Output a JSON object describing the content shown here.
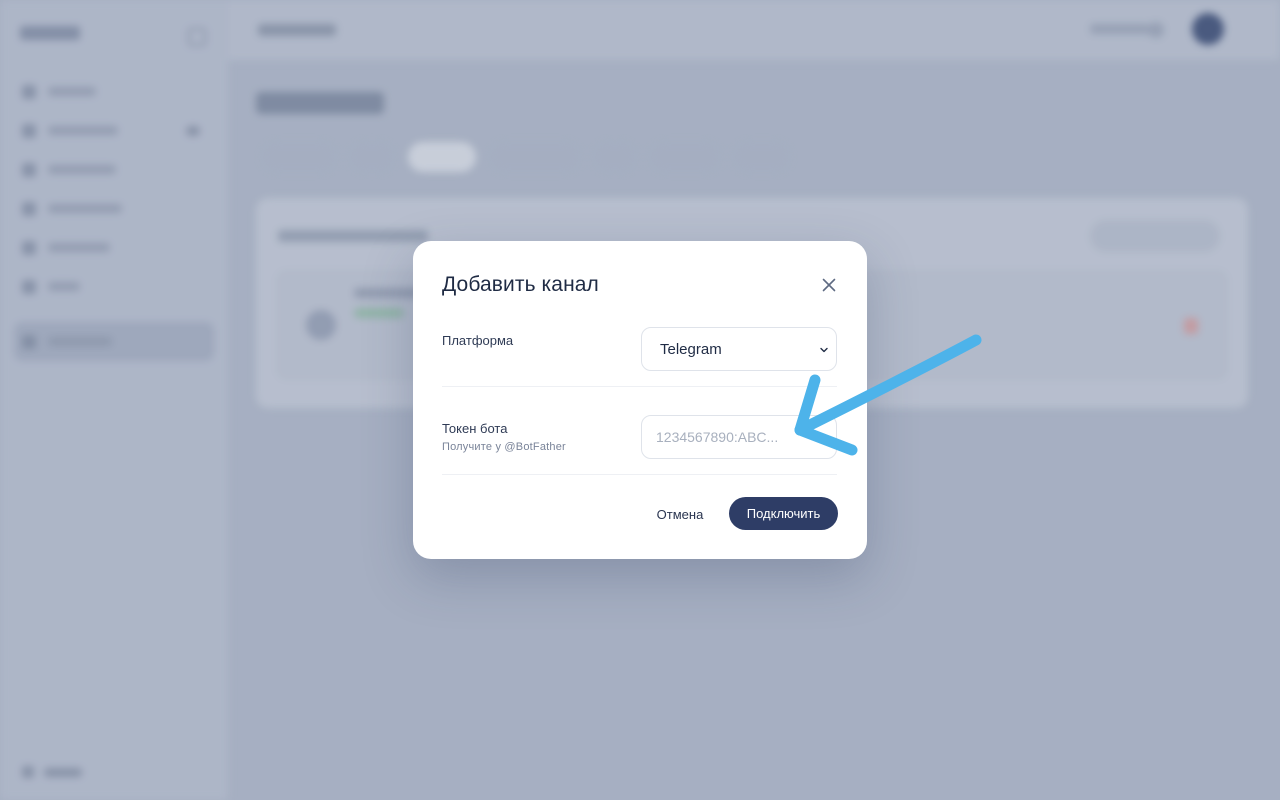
{
  "dialog": {
    "title": "Добавить канал",
    "close_icon": "close-icon",
    "platform": {
      "label": "Платформа",
      "selected": "Telegram",
      "chevron_icon": "chevron-down-icon"
    },
    "token": {
      "label": "Токен бота",
      "hint": "Получите у @BotFather",
      "value": "",
      "placeholder": "1234567890:ABC..."
    },
    "cancel_label": "Отмена",
    "submit_label": "Подключить"
  },
  "annotation": {
    "type": "arrow",
    "color": "#4db3ea",
    "points_to": "token-input"
  },
  "colors": {
    "primary": "#2e3d66",
    "overlay": "#b4bccc"
  }
}
